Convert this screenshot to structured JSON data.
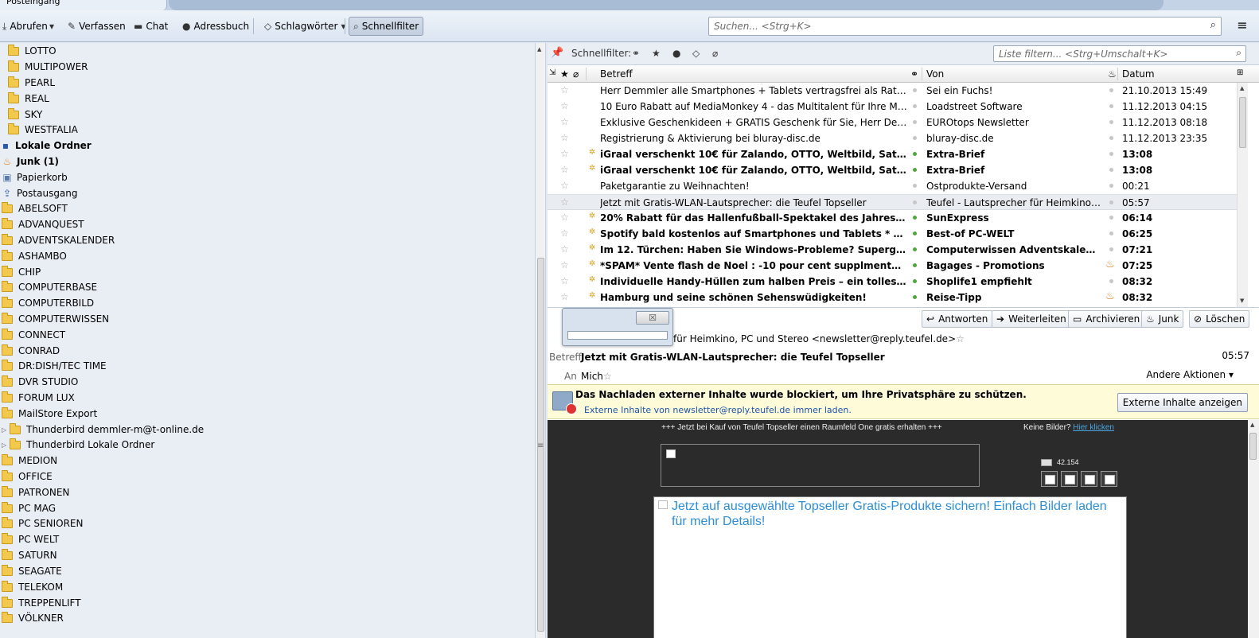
{
  "window": {
    "tab_title": "Posteingang"
  },
  "toolbar": {
    "fetch": "Abrufen",
    "compose": "Verfassen",
    "chat": "Chat",
    "addressbook": "Adressbuch",
    "tags": "Schlagwörter",
    "quickfilter": "Schnellfilter",
    "search_placeholder": "Suchen... <Strg+K>"
  },
  "folders": {
    "top": [
      "LOTTO",
      "MULTIPOWER",
      "PEARL",
      "REAL",
      "SKY",
      "WESTFALIA"
    ],
    "local_folders": "Lokale Ordner",
    "junk": "Junk (1)",
    "trash": "Papierkorb",
    "outbox": "Postausgang",
    "items": [
      "ABELSOFT",
      "ADVANQUEST",
      "ADVENTSKALENDER",
      "ASHAMBO",
      "CHIP",
      "COMPUTERBASE",
      "COMPUTERBILD",
      "COMPUTERWISSEN",
      "CONNECT",
      "CONRAD",
      "DR:DISH/TEC TIME",
      "DVR STUDIO",
      "FORUM LUX",
      "MailStore Export"
    ],
    "sub1": "Thunderbird demmler-m@t-online.de",
    "sub2": "Thunderbird Lokale Ordner",
    "items2": [
      "MEDION",
      "OFFICE",
      "PATRONEN",
      "PC MAG",
      "PC SENIOREN",
      "PC WELT",
      "SATURN",
      "SEAGATE",
      "TELEKOM",
      "TREPPENLIFT",
      "VÖLKNER"
    ]
  },
  "quickfilter": {
    "label": "Schnellfilter:",
    "filter_placeholder": "Liste filtern... <Strg+Umschalt+K>"
  },
  "columns": {
    "subject": "Betreff",
    "from": "Von",
    "date": "Datum"
  },
  "messages": [
    {
      "subject": "Herr Demmler alle Smartphones + Tablets vertragsfrei als Ratenkauf",
      "from": "Sei ein Fuchs!",
      "date": "21.10.2013 15:49"
    },
    {
      "subject": "10 Euro Rabatt auf MediaMonkey 4 - das Multitalent für Ihre Musikdateien",
      "from": "Loadstreet Software",
      "date": "11.12.2013 04:15"
    },
    {
      "subject": "Exklusive Geschenkideen + GRATIS Geschenk für Sie, Herr Demmler!",
      "from": "EUROtops Newsletter",
      "date": "11.12.2013 08:18"
    },
    {
      "subject": "Registrierung & Aktivierung bei bluray-disc.de",
      "from": "bluray-disc.de",
      "date": "11.12.2013 23:35"
    },
    {
      "subject": "iGraal verschenkt 10€ für Zalando, OTTO, Weltbild, Saturn u.v.m.",
      "from": "Extra-Brief",
      "date": "13:08"
    },
    {
      "subject": "iGraal verschenkt 10€ für Zalando, OTTO, Weltbild, Saturn u.v.m.",
      "from": "Extra-Brief",
      "date": "13:08"
    },
    {
      "subject": "Paketgarantie zu Weihnachten!",
      "from": "Ostprodukte-Versand",
      "date": "00:21"
    },
    {
      "subject": "Jetzt mit Gratis-WLAN-Lautsprecher: die Teufel Topseller",
      "from": "Teufel - Lautsprecher für Heimkino, PC ...",
      "date": "05:57"
    },
    {
      "subject": "20% Rabatt für das Hallenfußball-Spektakel des Jahres: Der 2. SunE...",
      "from": "SunExpress",
      "date": "06:14"
    },
    {
      "subject": "Spotify bald kostenlos auf Smartphones und Tablets * Smarty Ring w...",
      "from": "Best-of PC-WELT",
      "date": "06:25"
    },
    {
      "subject": "Im 12. Türchen: Haben Sie Windows-Probleme? Supergrobi hilft!",
      "from": "Computerwissen Adventskalender",
      "date": "07:21"
    },
    {
      "subject": "*SPAM* Vente flash de Noel : -10 pour cent supplmentaires sur tout ...",
      "from": "Bagages - Promotions",
      "date": "07:25"
    },
    {
      "subject": "Individuelle Handy-Hüllen zum halben Preis – ein tolles Geschenk!",
      "from": "Shoplife1 empfiehlt",
      "date": "08:32"
    },
    {
      "subject": "Hamburg und seine schönen Sehenswüdigkeiten!",
      "from": "Reise-Tipp",
      "date": "08:32"
    }
  ],
  "actions": {
    "reply": "Antworten",
    "forward": "Weiterleiten",
    "archive": "Archivieren",
    "junk": "Junk",
    "delete": "Löschen"
  },
  "header": {
    "from_text": "für Heimkino, PC und Stereo <newsletter@reply.teufel.de>",
    "subject_label": "Betreff",
    "subject": "Jetzt mit Gratis-WLAN-Lautsprecher: die Teufel Topseller",
    "time": "05:57",
    "to_label": "An",
    "to": "Mich",
    "more_actions": "Andere Aktionen"
  },
  "notice": {
    "text": "Das Nachladen externer Inhalte wurde blockiert, um Ihre Privatsphäre zu schützen.",
    "link": "Externe Inhalte von newsletter@reply.teufel.de immer laden.",
    "button": "Externe Inhalte anzeigen"
  },
  "email": {
    "promo": "+++ Jetzt bei Kauf von Teufel Topseller einen Raumfeld One gratis erhalten +++",
    "no_pics": "Keine Bilder?",
    "click_here": "Hier klicken",
    "count": "42.154",
    "main_text": "Jetzt auf ausgewählte Topseller Gratis-Produkte sichern! Einfach Bilder laden für mehr Details!"
  }
}
